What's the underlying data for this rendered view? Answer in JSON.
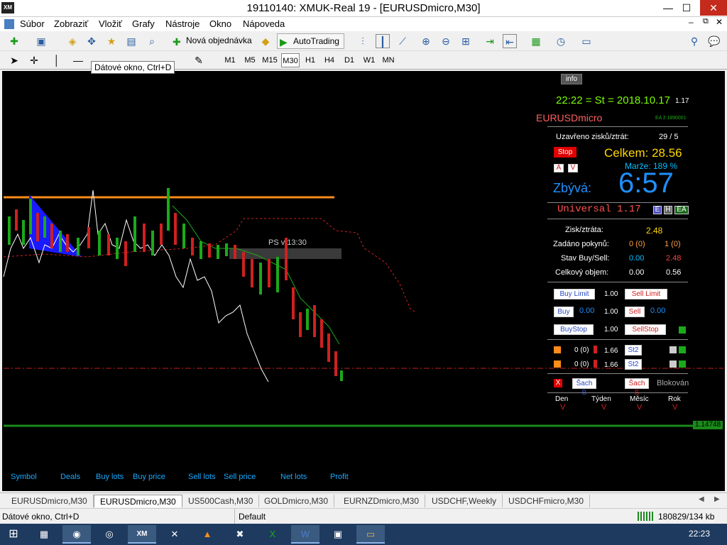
{
  "window": {
    "title": "19110140: XMUK-Real 19 - [EURUSDmicro,M30]",
    "logo": "XM"
  },
  "menu": [
    "Súbor",
    "Zobraziť",
    "Vložiť",
    "Grafy",
    "Nástroje",
    "Okno",
    "Nápoveda"
  ],
  "toolbar": {
    "new_order": "Nová objednávka",
    "autotrading": "AutoTrading"
  },
  "timeframes": [
    "M1",
    "M5",
    "M15",
    "M30",
    "H1",
    "H4",
    "D1",
    "W1",
    "MN"
  ],
  "active_timeframe": "M30",
  "tooltip": "Dátové okno, Ctrl+D",
  "panel": {
    "info_btn": "info",
    "clock": "22:22 = St = 2018.10.17",
    "clock_suffix": "1.17",
    "symbol": "EURUSDmicro",
    "ea_code": "EA ž:1890001",
    "closed_label": "Uzavřeno zisků/ztrát:",
    "closed_value": "29 / 5",
    "stop_btn": "Stop",
    "total": "Celkem: 28.56",
    "a_btn": "A",
    "v_btn": "V",
    "margin": "Marže:  189 %",
    "remaining_label": "Zbývá:",
    "remaining_time": "6:57",
    "universal": "Universal 1.17",
    "e_btn": "E",
    "h_btn": "H",
    "ea_btn": "EA",
    "pl_label": "Zisk/ztráta:",
    "pl_value": "2.48",
    "orders_label": "Zadáno pokynů:",
    "orders_buy": "0 (0)",
    "orders_sell": "1 (0)",
    "state_label": "Stav Buy/Sell:",
    "state_buy": "0.00",
    "state_sell": "2.48",
    "volume_label": "Celkový objem:",
    "volume_buy": "0.00",
    "volume_sell": "0.56",
    "buy_limit": "Buy Limit",
    "buy_limit_lot": "1.00",
    "sell_limit": "Sell Limit",
    "buy": "Buy",
    "buy_price": "0.00",
    "buy_lot": "1.00",
    "sell": "Sell",
    "sell_price": "0.00",
    "buy_stop": "BuyStop",
    "buy_stop_lot": "1.00",
    "sell_stop": "SellStop",
    "row1_count": "0 (0)",
    "row1_lot": "1.66",
    "row1_btn": "St2",
    "row2_count": "0 (0)",
    "row2_lot": "1.66",
    "row2_btn": "St2",
    "x_btn": "X",
    "sach_b": "Šach B",
    "sach_s": "Šach S",
    "blocked": "Blokován",
    "periods": [
      "Den",
      "Týden",
      "Měsíc",
      "Rok"
    ],
    "period_marker": "V"
  },
  "chart": {
    "ps_label": "PS v 13:30",
    "price_tag": "1.14748",
    "bottom_cols": [
      "Symbol",
      "Deals",
      "Buy lots",
      "Buy price",
      "Sell lots",
      "Sell price",
      "Net lots",
      "Profit"
    ]
  },
  "tabs": [
    "EURUSDmicro,M30",
    "EURUSDmicro,M30",
    "US500Cash,M30",
    "GOLDmicro,M30",
    "EURNZDmicro,M30",
    "USDCHF,Weekly",
    "USDCHFmicro,M30"
  ],
  "active_tab": 1,
  "status": {
    "left": "Dátové okno, Ctrl+D",
    "profile": "Default",
    "traffic": "180829/134 kb"
  },
  "taskbar": {
    "time": "22:23"
  },
  "colors": {
    "accent_green": "#7cfc00",
    "total_yellow": "#ffd700",
    "remaining_blue": "#1e90ff",
    "margin_cyan": "#00bfff",
    "sell_red": "#ff4040",
    "universal_red": "#ff5050"
  }
}
